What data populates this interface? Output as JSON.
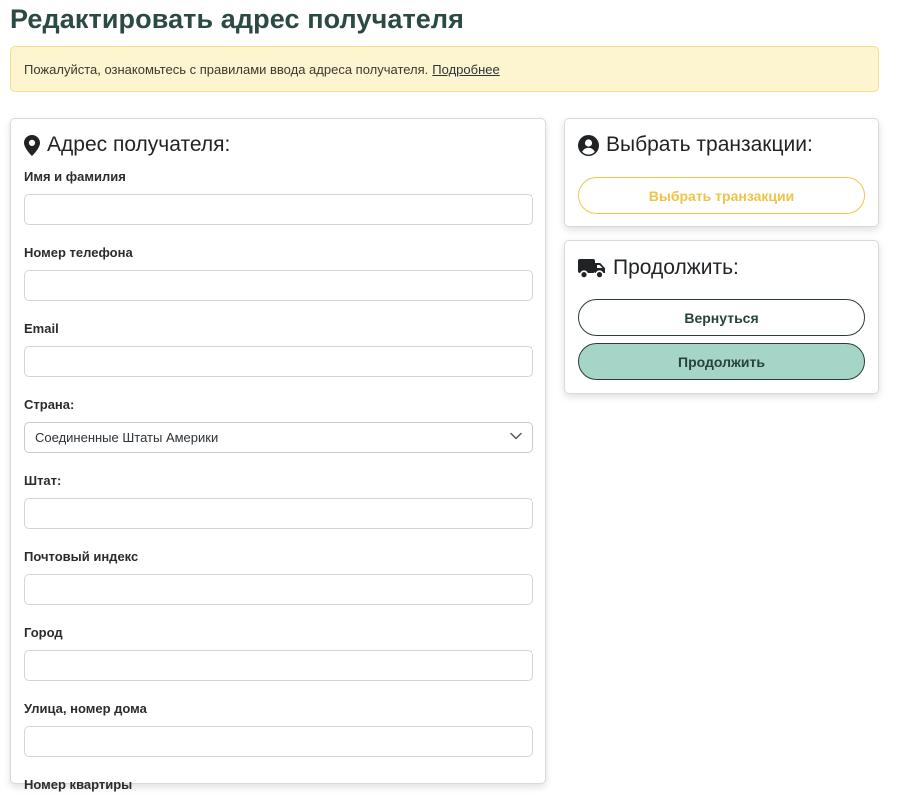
{
  "page": {
    "title": "Редактировать адрес получателя"
  },
  "notice": {
    "text": "Пожалуйста, ознакомьтесь с правилами ввода адреса получателя.",
    "link": "Подробнее"
  },
  "address_card": {
    "title": "Адрес получателя:",
    "icon": "map-marker-icon",
    "fields": {
      "full_name": {
        "label": "Имя и фамилия",
        "value": ""
      },
      "phone": {
        "label": "Номер телефона",
        "value": ""
      },
      "email": {
        "label": "Email",
        "value": ""
      },
      "country": {
        "label": "Страна:",
        "selected": "Соединенные Штаты Америки"
      },
      "state": {
        "label": "Штат:",
        "value": ""
      },
      "zip": {
        "label": "Почтовый индекс",
        "value": ""
      },
      "city": {
        "label": "Город",
        "value": ""
      },
      "street": {
        "label": "Улица, номер дома",
        "value": ""
      },
      "apartment": {
        "label": "Номер квартиры",
        "value": ""
      }
    }
  },
  "transactions_card": {
    "title": "Выбрать транзакции:",
    "icon": "user-circle-icon",
    "button": "Выбрать транзакции"
  },
  "continue_card": {
    "title": "Продолжить:",
    "icon": "truck-icon",
    "back_button": "Вернуться",
    "continue_button": "Продолжить"
  },
  "colors": {
    "title": "#2b4a43",
    "notice_bg": "#fdf4d0",
    "accent_yellow": "#efc34a",
    "accent_green": "#a5d5c6",
    "dark_outline": "#2b3d38"
  }
}
